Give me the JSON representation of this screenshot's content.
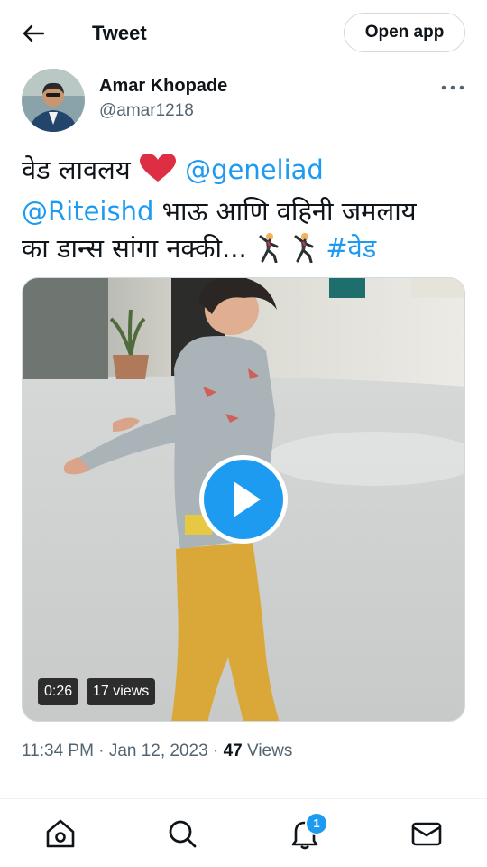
{
  "header": {
    "title": "Tweet",
    "open_app_label": "Open app"
  },
  "author": {
    "name": "Amar Khopade",
    "handle": "@amar1218"
  },
  "tweet": {
    "line1_text": "वेड लावलय ",
    "line1_mention": "@geneliad",
    "line2_mention": "@Riteishd",
    "line2_text": " भाऊ आणि वहिनी जमलाय",
    "line3_text": "का डान्स सांगा नक्की... ",
    "hashtag": "#वेड"
  },
  "media": {
    "duration": "0:26",
    "views_label": "17 views"
  },
  "meta": {
    "time": "11:34 PM",
    "separator": "·",
    "date": "Jan 12, 2023",
    "views_count": "47",
    "views_label": "Views"
  },
  "nav": {
    "notifications_count": "1"
  },
  "icons": [
    "back-arrow-icon",
    "more-icon",
    "heart-emoji-icon",
    "dancing-man-emoji-icon",
    "play-icon",
    "home-icon",
    "search-icon",
    "bell-icon",
    "mail-icon"
  ],
  "colors": {
    "accent": "#1d9bf0",
    "text": "#0f1419",
    "secondary": "#536471",
    "heart": "#dd2e44"
  }
}
